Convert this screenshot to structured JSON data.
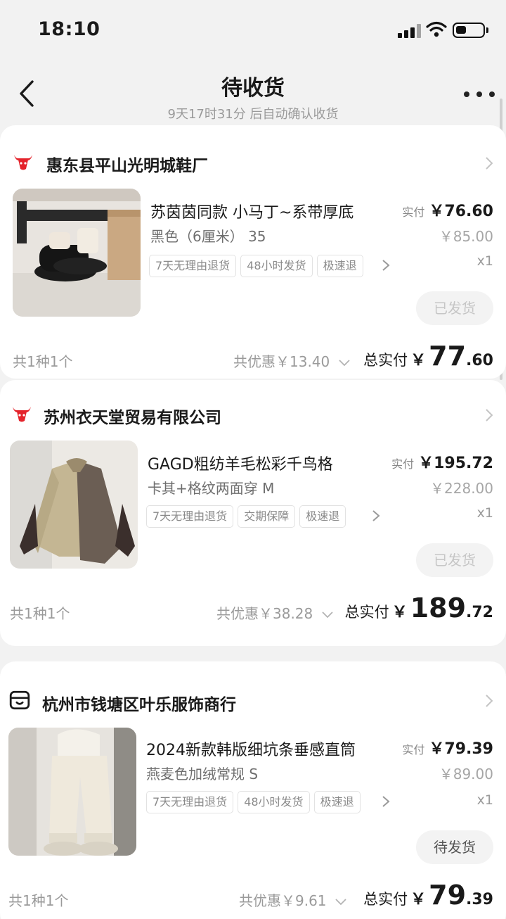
{
  "status_bar": {
    "time": "18:10"
  },
  "nav": {
    "title": "待收货",
    "subtitle": "9天17时31分 后自动确认收货"
  },
  "colors": {
    "accent_red": "#e4232b",
    "text_dark": "#1a1a1a",
    "text_gray": "#9a9a9a"
  },
  "orders": [
    {
      "shop_icon": "bull-head-icon",
      "shop_name": "惠东县平山光明城鞋厂",
      "product_title": "苏茵茵同款 小马丁~系带厚底",
      "spec": "黑色（6厘米） 35",
      "tags": [
        "7天无理由退货",
        "48小时发货",
        "极速退"
      ],
      "price_label": "实付",
      "price": "￥76.60",
      "original_price": "￥85.00",
      "quantity": "x1",
      "status": "已发货",
      "count": "共1种1个",
      "discount": "共优惠￥13.40",
      "total_label": "总实付",
      "total_yen": "￥",
      "total_int": "77",
      "total_dec": ".60"
    },
    {
      "shop_icon": "bull-head-icon",
      "shop_name": "苏州衣天堂贸易有限公司",
      "product_title": "GAGD粗纺羊毛松彩千鸟格",
      "spec": "卡其+格纹两面穿 M",
      "tags": [
        "7天无理由退货",
        "交期保障",
        "极速退"
      ],
      "price_label": "实付",
      "price": "￥195.72",
      "original_price": "￥228.00",
      "quantity": "x1",
      "status": "已发货",
      "count": "共1种1个",
      "discount": "共优惠￥38.28",
      "total_label": "总实付",
      "total_yen": "￥",
      "total_int": "189",
      "total_dec": ".72"
    },
    {
      "shop_icon": "store-icon",
      "shop_name": "杭州市钱塘区叶乐服饰商行",
      "product_title": "2024新款韩版细坑条垂感直筒",
      "spec": "燕麦色加绒常规 S",
      "tags": [
        "7天无理由退货",
        "48小时发货",
        "极速退"
      ],
      "price_label": "实付",
      "price": "￥79.39",
      "original_price": "￥89.00",
      "quantity": "x1",
      "status": "待发货",
      "count": "共1种1个",
      "discount": "共优惠￥9.61",
      "total_label": "总实付",
      "total_yen": "￥",
      "total_int": "79",
      "total_dec": ".39"
    }
  ]
}
